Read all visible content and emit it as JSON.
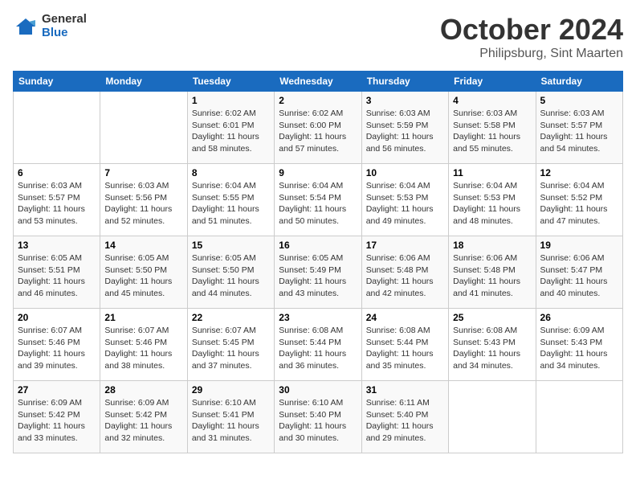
{
  "header": {
    "logo": {
      "general": "General",
      "blue": "Blue"
    },
    "title": "October 2024",
    "location": "Philipsburg, Sint Maarten"
  },
  "calendar": {
    "days_of_week": [
      "Sunday",
      "Monday",
      "Tuesday",
      "Wednesday",
      "Thursday",
      "Friday",
      "Saturday"
    ],
    "weeks": [
      [
        {
          "day": "",
          "info": ""
        },
        {
          "day": "",
          "info": ""
        },
        {
          "day": "1",
          "info": "Sunrise: 6:02 AM\nSunset: 6:01 PM\nDaylight: 11 hours and 58 minutes."
        },
        {
          "day": "2",
          "info": "Sunrise: 6:02 AM\nSunset: 6:00 PM\nDaylight: 11 hours and 57 minutes."
        },
        {
          "day": "3",
          "info": "Sunrise: 6:03 AM\nSunset: 5:59 PM\nDaylight: 11 hours and 56 minutes."
        },
        {
          "day": "4",
          "info": "Sunrise: 6:03 AM\nSunset: 5:58 PM\nDaylight: 11 hours and 55 minutes."
        },
        {
          "day": "5",
          "info": "Sunrise: 6:03 AM\nSunset: 5:57 PM\nDaylight: 11 hours and 54 minutes."
        }
      ],
      [
        {
          "day": "6",
          "info": "Sunrise: 6:03 AM\nSunset: 5:57 PM\nDaylight: 11 hours and 53 minutes."
        },
        {
          "day": "7",
          "info": "Sunrise: 6:03 AM\nSunset: 5:56 PM\nDaylight: 11 hours and 52 minutes."
        },
        {
          "day": "8",
          "info": "Sunrise: 6:04 AM\nSunset: 5:55 PM\nDaylight: 11 hours and 51 minutes."
        },
        {
          "day": "9",
          "info": "Sunrise: 6:04 AM\nSunset: 5:54 PM\nDaylight: 11 hours and 50 minutes."
        },
        {
          "day": "10",
          "info": "Sunrise: 6:04 AM\nSunset: 5:53 PM\nDaylight: 11 hours and 49 minutes."
        },
        {
          "day": "11",
          "info": "Sunrise: 6:04 AM\nSunset: 5:53 PM\nDaylight: 11 hours and 48 minutes."
        },
        {
          "day": "12",
          "info": "Sunrise: 6:04 AM\nSunset: 5:52 PM\nDaylight: 11 hours and 47 minutes."
        }
      ],
      [
        {
          "day": "13",
          "info": "Sunrise: 6:05 AM\nSunset: 5:51 PM\nDaylight: 11 hours and 46 minutes."
        },
        {
          "day": "14",
          "info": "Sunrise: 6:05 AM\nSunset: 5:50 PM\nDaylight: 11 hours and 45 minutes."
        },
        {
          "day": "15",
          "info": "Sunrise: 6:05 AM\nSunset: 5:50 PM\nDaylight: 11 hours and 44 minutes."
        },
        {
          "day": "16",
          "info": "Sunrise: 6:05 AM\nSunset: 5:49 PM\nDaylight: 11 hours and 43 minutes."
        },
        {
          "day": "17",
          "info": "Sunrise: 6:06 AM\nSunset: 5:48 PM\nDaylight: 11 hours and 42 minutes."
        },
        {
          "day": "18",
          "info": "Sunrise: 6:06 AM\nSunset: 5:48 PM\nDaylight: 11 hours and 41 minutes."
        },
        {
          "day": "19",
          "info": "Sunrise: 6:06 AM\nSunset: 5:47 PM\nDaylight: 11 hours and 40 minutes."
        }
      ],
      [
        {
          "day": "20",
          "info": "Sunrise: 6:07 AM\nSunset: 5:46 PM\nDaylight: 11 hours and 39 minutes."
        },
        {
          "day": "21",
          "info": "Sunrise: 6:07 AM\nSunset: 5:46 PM\nDaylight: 11 hours and 38 minutes."
        },
        {
          "day": "22",
          "info": "Sunrise: 6:07 AM\nSunset: 5:45 PM\nDaylight: 11 hours and 37 minutes."
        },
        {
          "day": "23",
          "info": "Sunrise: 6:08 AM\nSunset: 5:44 PM\nDaylight: 11 hours and 36 minutes."
        },
        {
          "day": "24",
          "info": "Sunrise: 6:08 AM\nSunset: 5:44 PM\nDaylight: 11 hours and 35 minutes."
        },
        {
          "day": "25",
          "info": "Sunrise: 6:08 AM\nSunset: 5:43 PM\nDaylight: 11 hours and 34 minutes."
        },
        {
          "day": "26",
          "info": "Sunrise: 6:09 AM\nSunset: 5:43 PM\nDaylight: 11 hours and 34 minutes."
        }
      ],
      [
        {
          "day": "27",
          "info": "Sunrise: 6:09 AM\nSunset: 5:42 PM\nDaylight: 11 hours and 33 minutes."
        },
        {
          "day": "28",
          "info": "Sunrise: 6:09 AM\nSunset: 5:42 PM\nDaylight: 11 hours and 32 minutes."
        },
        {
          "day": "29",
          "info": "Sunrise: 6:10 AM\nSunset: 5:41 PM\nDaylight: 11 hours and 31 minutes."
        },
        {
          "day": "30",
          "info": "Sunrise: 6:10 AM\nSunset: 5:40 PM\nDaylight: 11 hours and 30 minutes."
        },
        {
          "day": "31",
          "info": "Sunrise: 6:11 AM\nSunset: 5:40 PM\nDaylight: 11 hours and 29 minutes."
        },
        {
          "day": "",
          "info": ""
        },
        {
          "day": "",
          "info": ""
        }
      ]
    ]
  }
}
